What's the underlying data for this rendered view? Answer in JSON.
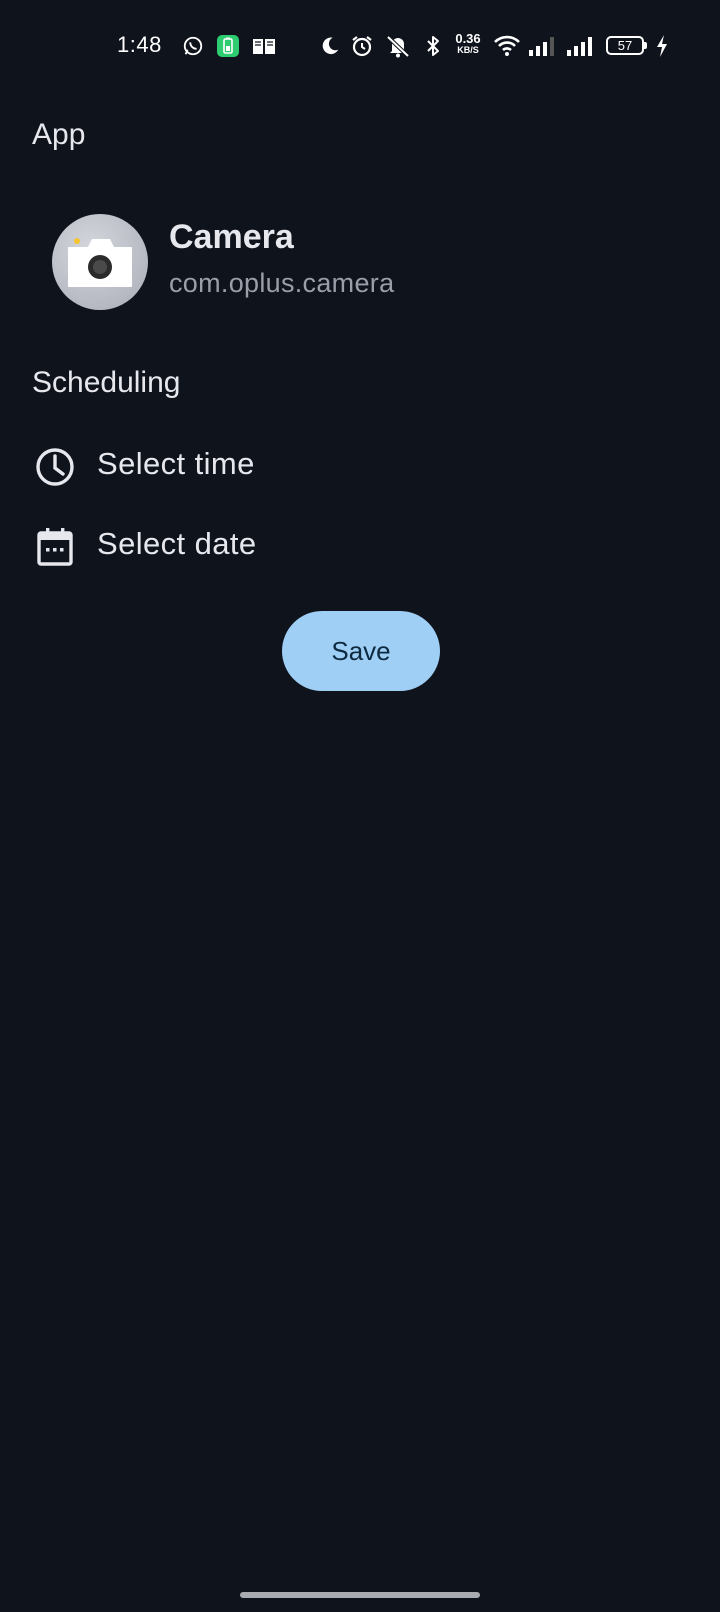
{
  "status_bar": {
    "time": "1:48",
    "net_speed_value": "0.36",
    "net_speed_unit": "KB/S",
    "battery_level": "57",
    "icons": [
      "whatsapp-icon",
      "battery-saver-icon",
      "book-icon",
      "moon-icon",
      "alarm-icon",
      "mute-icon",
      "bluetooth-icon",
      "wifi-icon",
      "signal-icon",
      "signal-icon-2",
      "charging-icon"
    ]
  },
  "sections": {
    "app_header": "App",
    "scheduling_header": "Scheduling"
  },
  "app": {
    "name": "Camera",
    "package": "com.oplus.camera",
    "icon": "camera-icon"
  },
  "scheduling": {
    "time_label": "Select time",
    "date_label": "Select date",
    "time_icon": "clock-icon",
    "date_icon": "calendar-icon"
  },
  "actions": {
    "save_label": "Save"
  },
  "colors": {
    "background": "#0f131c",
    "primary_button": "#9fcff5",
    "primary_button_text": "#0e2a40",
    "secondary_text": "#9a9ea8"
  }
}
